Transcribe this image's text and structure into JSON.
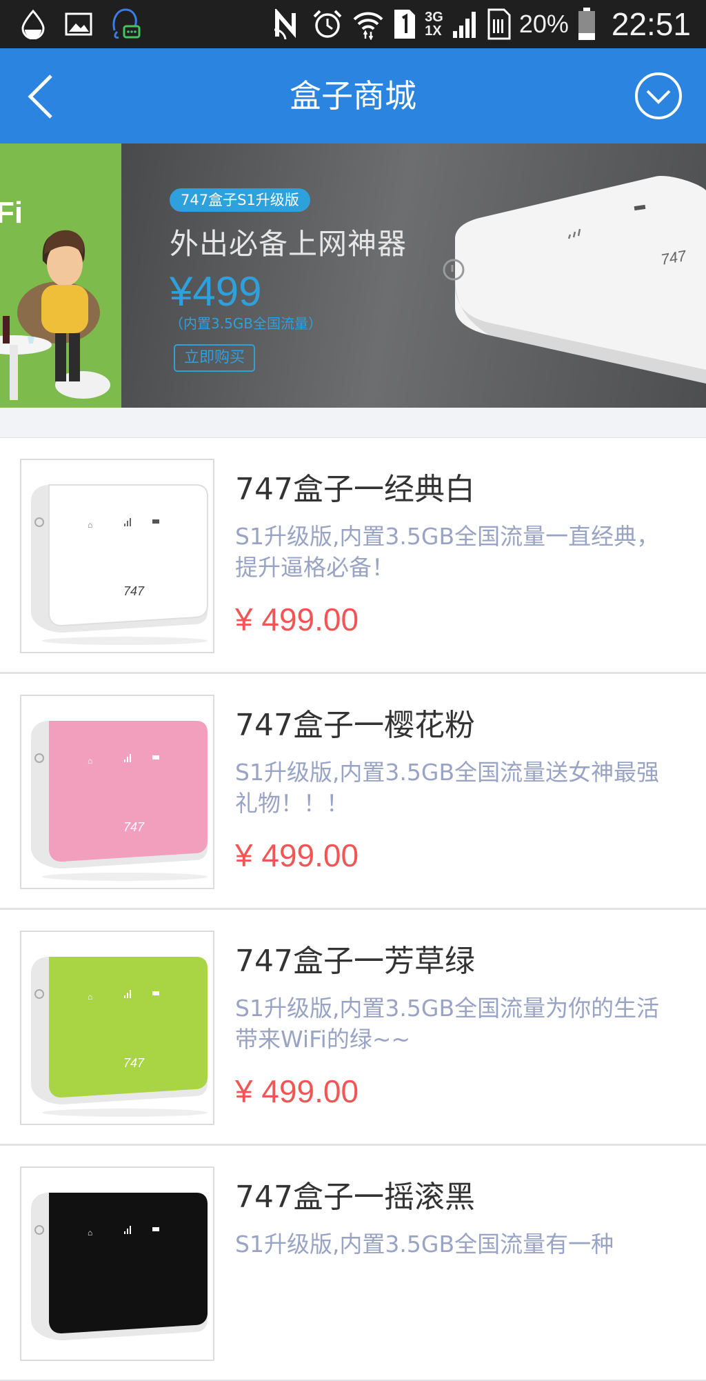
{
  "status_bar": {
    "left_icons": [
      "water-drop-icon",
      "image-icon",
      "chat-robot-icon"
    ],
    "right_icons": [
      "nfc-icon",
      "alarm-icon",
      "wifi-icon",
      "sim1-icon",
      "signal-icon",
      "sim-storage-icon",
      "battery-icon"
    ],
    "network_top": "3G",
    "network_bottom": "1X",
    "battery": "20%",
    "time": "22:51"
  },
  "header": {
    "title": "盒子商城",
    "back_icon": "chevron-left-icon",
    "menu_icon": "chevron-circle-icon"
  },
  "banner": {
    "tag": "747盒子S1升级版",
    "headline": "外出必备上网神器",
    "price": "¥499",
    "note": "（内置3.5GB全国流量）",
    "buy_label": "立即购买",
    "left_partial_text": "Fi",
    "slide_count": 2,
    "active_slide": 2
  },
  "products": [
    {
      "name": "747盒子一经典白",
      "desc": "S1升级版,内置3.5GB全国流量一直经典，提升逼格必备！",
      "price": "¥ 499.00",
      "color": "#ffffff"
    },
    {
      "name": "747盒子一樱花粉",
      "desc": "S1升级版,内置3.5GB全国流量送女神最强礼物！！！",
      "price": "¥ 499.00",
      "color": "#f29ebd"
    },
    {
      "name": "747盒子一芳草绿",
      "desc": "S1升级版,内置3.5GB全国流量为你的生活带来WiFi的绿~~",
      "price": "¥ 499.00",
      "color": "#a9d443"
    },
    {
      "name": "747盒子一摇滚黑",
      "desc": "S1升级版,内置3.5GB全国流量有一种",
      "price": "",
      "color": "#111111"
    }
  ],
  "colors": {
    "header": "#2b85e0",
    "price": "#f25555",
    "description": "#99a3c4",
    "accent_blue": "#2ea1dd",
    "dot_active": "#f06a2c"
  }
}
